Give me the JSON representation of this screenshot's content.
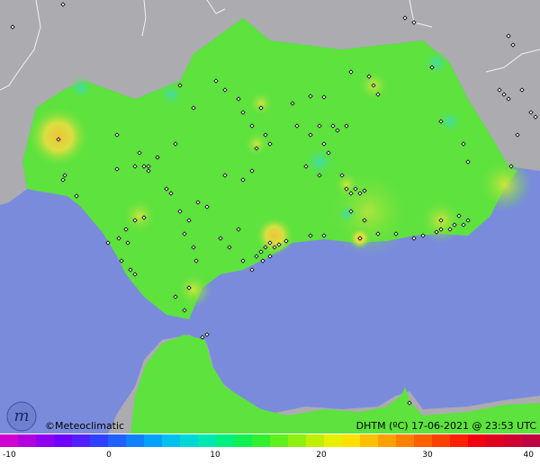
{
  "footer": {
    "brand": "©Meteoclimatic",
    "caption": "DHTM (ºC)  17-06-2021 @ 23:53 UTC",
    "logo_letter": "m"
  },
  "colorbar": {
    "labels": [
      "-10",
      "0",
      "10",
      "20",
      "30",
      "40"
    ],
    "min": -10,
    "max": 40,
    "colors": [
      "#d000d0",
      "#b000e0",
      "#9000f0",
      "#7000ff",
      "#5020ff",
      "#3040ff",
      "#2060ff",
      "#1080ff",
      "#00a0ff",
      "#00c0f0",
      "#00d8d8",
      "#00e8b0",
      "#00f080",
      "#10f050",
      "#30f030",
      "#60f020",
      "#90f010",
      "#c0f000",
      "#e8f000",
      "#ffe000",
      "#ffc000",
      "#ffa000",
      "#ff8000",
      "#ff6000",
      "#ff4000",
      "#ff2000",
      "#f00010",
      "#e00020",
      "#d00030",
      "#c00040"
    ]
  },
  "colors": {
    "sea": "#7b8bdc",
    "land_outside": "#a9a9ad",
    "region": "#5de23e",
    "warm": "#c9e63e",
    "hot": "#f0d040",
    "cool": "#49e08a"
  }
}
